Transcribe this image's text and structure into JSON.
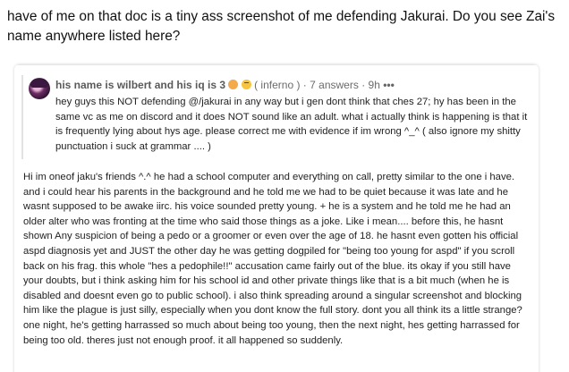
{
  "intro_text": "have of me on that doc is a tiny ass screenshot of me defending Jakurai. Do you see Zai's name anywhere listed here?",
  "answer": {
    "author": "his name is wilbert and his iq is 3",
    "emoji_icons": [
      "flushed-face-icon",
      "sad-face-icon"
    ],
    "space": "( inferno )",
    "separator1": "·",
    "answer_count": "7 answers",
    "separator2": "·",
    "time": "9h",
    "more": "•••",
    "body": "hey guys this NOT defending @/jakurai in any way but i gen dont think that ches 27; hy has been in the same vc as me on discord and it does NOT sound like an adult. what i actually think is happening is that it is frequently lying about hys age. please correct me with evidence if im wrong ^_^ ( also ignore my shitty punctuation i suck at grammar .... )"
  },
  "comment": {
    "body": "Hi im oneof jaku's friends ^.^ he had a school computer and everything on call, pretty similar to the one i have. and i could hear his parents in the background and he told me we had to be quiet because it was late and he wasnt supposed to be awake iirc. his voice sounded pretty young. + he is a system and he told me he had an older alter who was fronting at the time who said those things as a joke. Like i mean.... before this, he hasnt shown Any suspicion of being a pedo or a groomer or even over the age of 18. he hasnt even gotten his official aspd diagnosis yet and JUST the other day he was getting dogpiled for \"being too young for aspd\" if you scroll back on his frag. this whole \"hes a pedophile!!\" accusation came fairly out of the blue. its okay if you still have your doubts, but i think asking him for his school id and other private things like that is a bit much (when he is disabled and doesnt even go to public school). i also think spreading around a singular screenshot and blocking him like the plague is just silly, especially when you dont know the full story. dont you all think its a little strange? one night, he's getting harrassed so much about being too young, then the next night, hes getting harrassed for being too old. theres just not enough proof. it all happened so suddenly."
  }
}
